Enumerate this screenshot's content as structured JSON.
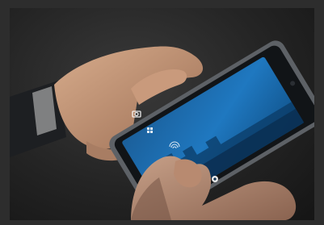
{
  "photo": {
    "subject": "hands-holding-smartphone",
    "screen": {
      "title": "",
      "subtitle": ""
    },
    "icons": [
      "camera-icon",
      "grid-icon",
      "fingerprint-icon",
      "settings-icon"
    ]
  },
  "colors": {
    "background": "#2d2d2d",
    "screen_blue": "#1a6fb0",
    "skin": "#c89a7a",
    "phone_body": "#6f747a"
  }
}
